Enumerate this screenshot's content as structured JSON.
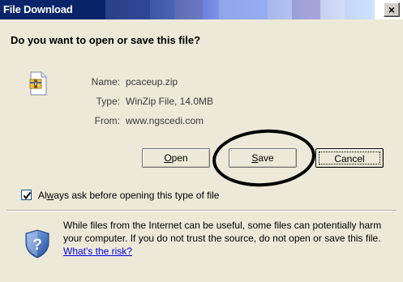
{
  "window": {
    "title": "File Download",
    "close_glyph": "×"
  },
  "dialog": {
    "question": "Do you want to open or save this file?",
    "file": {
      "icon": "zip-file-icon",
      "name_label": "Name:",
      "name_value": "pcaceup.zip",
      "type_label": "Type:",
      "type_value": "WinZip File, 14.0MB",
      "from_label": "From:",
      "from_value": "www.ngscedi.com"
    },
    "buttons": {
      "open_mnemonic": "O",
      "open_rest": "pen",
      "save_mnemonic": "S",
      "save_rest": "ave",
      "cancel": "Cancel"
    },
    "checkbox": {
      "checked": true,
      "label_pre": "Al",
      "label_mnemonic": "w",
      "label_post": "ays ask before opening this type of file"
    },
    "warning": {
      "icon": "security-shield-icon",
      "text": "While files from the Internet can be useful, some files can potentially harm your computer. If you do not trust the source, do not open or save this file.",
      "link": "What's the risk?"
    },
    "annotation": "hand-drawn-circle-around-save"
  },
  "colors": {
    "titlebar": "#0a246a",
    "dialog_bg": "#ece9d8",
    "link": "#0000ee"
  }
}
